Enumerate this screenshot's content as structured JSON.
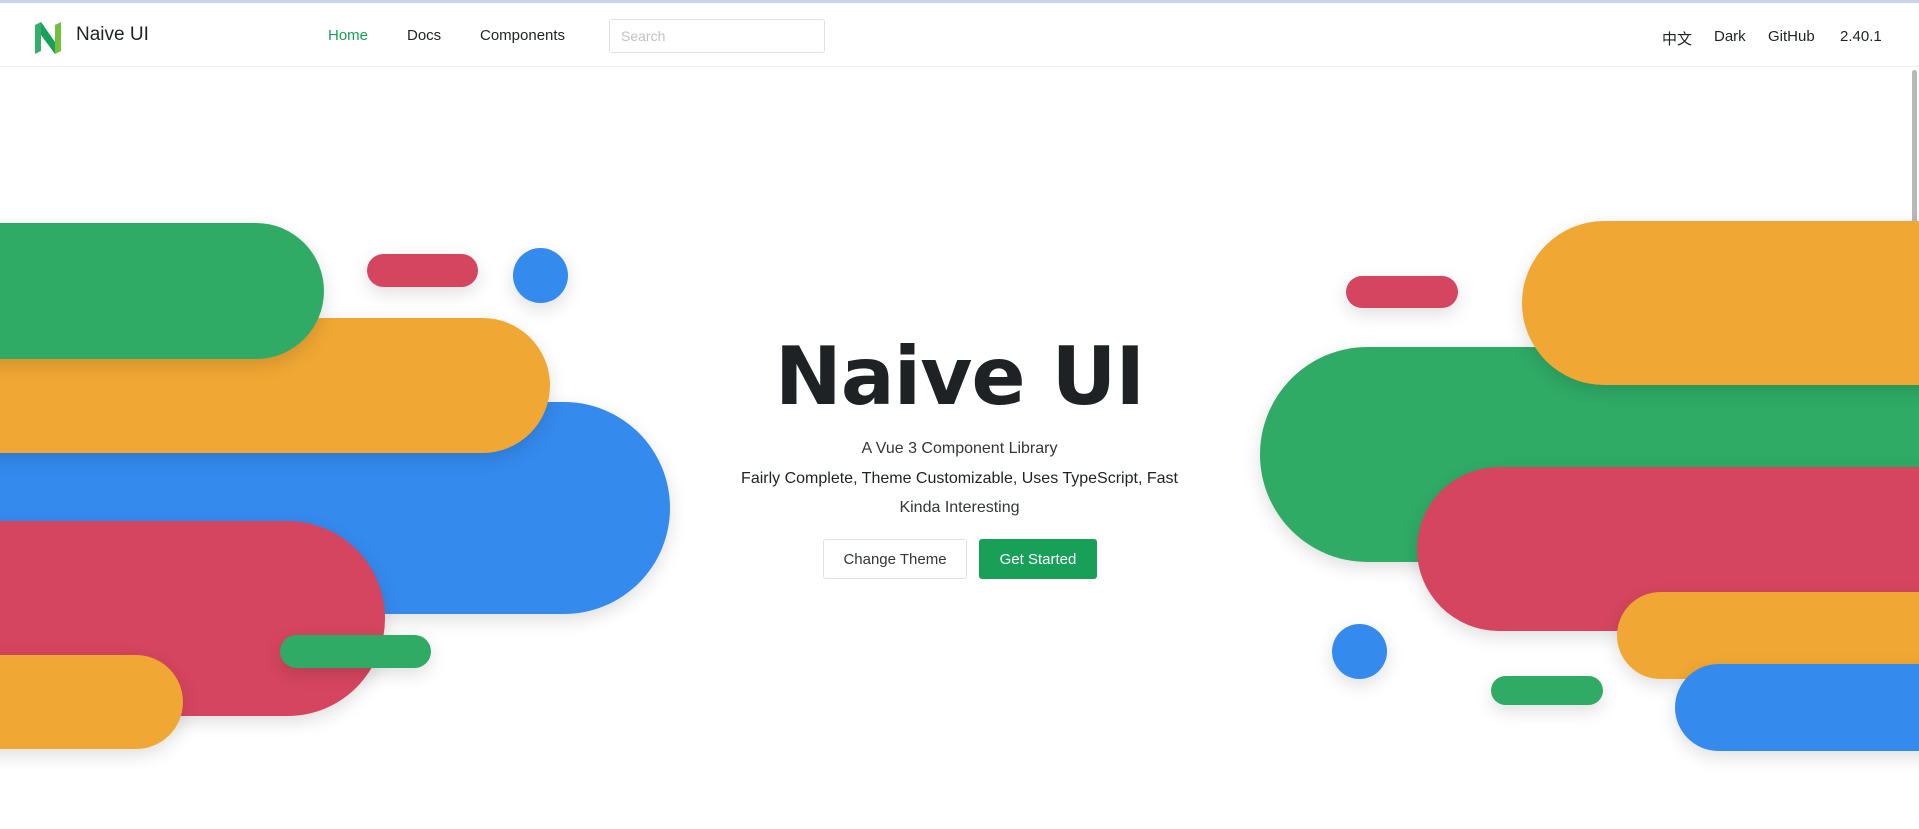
{
  "header": {
    "brand": "Naive UI",
    "nav": {
      "home": "Home",
      "docs": "Docs",
      "components": "Components"
    },
    "search_placeholder": "Search",
    "links": {
      "lang": "中文",
      "theme": "Dark",
      "github": "GitHub",
      "version": "2.40.1"
    }
  },
  "hero": {
    "title": "Naive UI",
    "tagline": "A Vue 3 Component Library",
    "features": "Fairly Complete, Theme Customizable, Uses TypeScript, Fast",
    "note": "Kinda Interesting",
    "change_theme": "Change Theme",
    "get_started": "Get Started"
  },
  "colors": {
    "brand_green": "#18a058",
    "shape_green": "#2fab66",
    "shape_yellow": "#f0a733",
    "shape_blue": "#358aee",
    "shape_red": "#d5455f"
  },
  "icons": {
    "logo": "naive-ui-logo-icon"
  }
}
